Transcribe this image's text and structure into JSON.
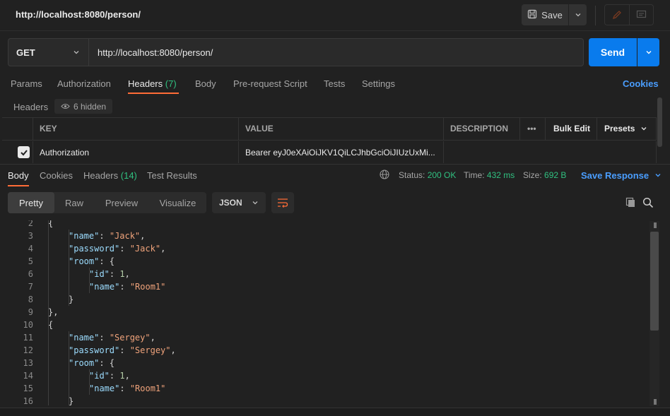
{
  "header": {
    "title": "http://localhost:8080/person/",
    "save_label": "Save"
  },
  "request": {
    "method": "GET",
    "url": "http://localhost:8080/person/",
    "send_label": "Send"
  },
  "req_tabs": [
    {
      "label": "Params"
    },
    {
      "label": "Authorization"
    },
    {
      "label": "Headers",
      "count": "(7)"
    },
    {
      "label": "Body"
    },
    {
      "label": "Pre-request Script"
    },
    {
      "label": "Tests"
    },
    {
      "label": "Settings"
    }
  ],
  "cookies_label": "Cookies",
  "headers_section": {
    "label": "Headers",
    "hidden": "6 hidden",
    "columns": {
      "key": "KEY",
      "value": "VALUE",
      "description": "DESCRIPTION",
      "more": "•••",
      "bulk_edit": "Bulk Edit",
      "presets": "Presets"
    },
    "rows": [
      {
        "key": "Authorization",
        "value": "Bearer eyJ0eXAiOiJKV1QiLCJhbGciOiJIUzUxMi...",
        "checked": true
      }
    ]
  },
  "response": {
    "tabs": [
      {
        "label": "Body"
      },
      {
        "label": "Cookies"
      },
      {
        "label": "Headers",
        "count": "(14)"
      },
      {
        "label": "Test Results"
      }
    ],
    "status_label": "Status:",
    "status_value": "200 OK",
    "time_label": "Time:",
    "time_value": "432 ms",
    "size_label": "Size:",
    "size_value": "692 B",
    "save_response": "Save Response",
    "views": [
      "Pretty",
      "Raw",
      "Preview",
      "Visualize"
    ],
    "format": "JSON"
  },
  "code_lines": [
    {
      "n": "2",
      "indent": 1,
      "tokens": [
        [
          "p",
          "{"
        ]
      ]
    },
    {
      "n": "3",
      "indent": 2,
      "tokens": [
        [
          "k",
          "\"name\""
        ],
        [
          "p",
          ": "
        ],
        [
          "s",
          "\"Jack\""
        ],
        [
          "p",
          ","
        ]
      ]
    },
    {
      "n": "4",
      "indent": 2,
      "tokens": [
        [
          "k",
          "\"password\""
        ],
        [
          "p",
          ": "
        ],
        [
          "s",
          "\"Jack\""
        ],
        [
          "p",
          ","
        ]
      ]
    },
    {
      "n": "5",
      "indent": 2,
      "tokens": [
        [
          "k",
          "\"room\""
        ],
        [
          "p",
          ": {"
        ]
      ]
    },
    {
      "n": "6",
      "indent": 3,
      "tokens": [
        [
          "k",
          "\"id\""
        ],
        [
          "p",
          ": "
        ],
        [
          "n",
          "1"
        ],
        [
          "p",
          ","
        ]
      ]
    },
    {
      "n": "7",
      "indent": 3,
      "tokens": [
        [
          "k",
          "\"name\""
        ],
        [
          "p",
          ": "
        ],
        [
          "s",
          "\"Room1\""
        ]
      ]
    },
    {
      "n": "8",
      "indent": 2,
      "tokens": [
        [
          "p",
          "}"
        ]
      ]
    },
    {
      "n": "9",
      "indent": 1,
      "tokens": [
        [
          "p",
          "},"
        ]
      ]
    },
    {
      "n": "10",
      "indent": 1,
      "tokens": [
        [
          "p",
          "{"
        ]
      ]
    },
    {
      "n": "11",
      "indent": 2,
      "tokens": [
        [
          "k",
          "\"name\""
        ],
        [
          "p",
          ": "
        ],
        [
          "s",
          "\"Sergey\""
        ],
        [
          "p",
          ","
        ]
      ]
    },
    {
      "n": "12",
      "indent": 2,
      "tokens": [
        [
          "k",
          "\"password\""
        ],
        [
          "p",
          ": "
        ],
        [
          "s",
          "\"Sergey\""
        ],
        [
          "p",
          ","
        ]
      ]
    },
    {
      "n": "13",
      "indent": 2,
      "tokens": [
        [
          "k",
          "\"room\""
        ],
        [
          "p",
          ": {"
        ]
      ]
    },
    {
      "n": "14",
      "indent": 3,
      "tokens": [
        [
          "k",
          "\"id\""
        ],
        [
          "p",
          ": "
        ],
        [
          "n",
          "1"
        ],
        [
          "p",
          ","
        ]
      ]
    },
    {
      "n": "15",
      "indent": 3,
      "tokens": [
        [
          "k",
          "\"name\""
        ],
        [
          "p",
          ": "
        ],
        [
          "s",
          "\"Room1\""
        ]
      ]
    },
    {
      "n": "16",
      "indent": 2,
      "tokens": [
        [
          "p",
          "}"
        ]
      ]
    }
  ]
}
